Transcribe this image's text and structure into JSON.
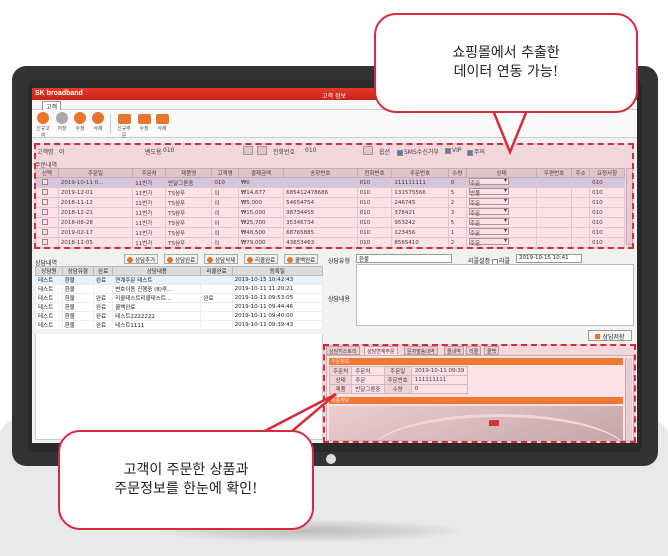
{
  "callouts": {
    "top": "쇼핑몰에서 추출한\n데이터 연동 가능!",
    "bottom": "고객이 주문한 상품과\n주문정보를 한눈에 확인!"
  },
  "app": {
    "brand": "SK broadband",
    "window_title": "고객 정보",
    "menu": "고객"
  },
  "toolbar": {
    "buttons": [
      "신규고객",
      "저장",
      "수정",
      "삭제",
      "신규주문",
      "수정",
      "삭제"
    ]
  },
  "customer": {
    "name_label": "고객명",
    "name_value": "이",
    "vendor_label": "벤도용",
    "vendor_value": "010",
    "phone_label": "전화번호",
    "phone_value": "010",
    "checks_label": "옵션",
    "checks": [
      "SMS수신거부",
      "VIP",
      "주의"
    ]
  },
  "orders": {
    "section_label": "주문내역",
    "columns": [
      "선택",
      "주문일",
      "주문처",
      "제품명",
      "고객명",
      "결제금액",
      "송장번호",
      "전화번호",
      "주문번호",
      "수량",
      "상태",
      "우편번호",
      "주소",
      "요청사항"
    ],
    "rows": [
      [
        "",
        "2019-10-11 0...",
        "11번가",
        "반달그론중",
        "010",
        "₩0",
        "",
        "010",
        "111111111",
        "0",
        "주문",
        "",
        "",
        "010"
      ],
      [
        "",
        "2019-12-01",
        "11번가",
        "TS샴푸",
        "이",
        "₩14,677",
        "685412478686",
        "010",
        "131575566",
        "5",
        "반품",
        "",
        "",
        "010"
      ],
      [
        "",
        "2018-11-12",
        "11번가",
        "TS샴푸",
        "이",
        "₩5,000",
        "54654754",
        "010",
        "246745",
        "2",
        "주문",
        "",
        "",
        "010"
      ],
      [
        "",
        "2018-12-21",
        "11번가",
        "TS샴푸",
        "이",
        "₩15,000",
        "98734455",
        "010",
        "378421",
        "3",
        "주문",
        "",
        "",
        "010"
      ],
      [
        "",
        "2018-08-28",
        "11번가",
        "TS샴푸",
        "이",
        "₩25,700",
        "35346734",
        "010",
        "953242",
        "5",
        "주문",
        "",
        "",
        "010"
      ],
      [
        "",
        "2019-02-17",
        "11번가",
        "TS샴푸",
        "이",
        "₩48,500",
        "68765885",
        "010",
        "123456",
        "1",
        "주문",
        "",
        "",
        "010"
      ],
      [
        "",
        "2018-12-05",
        "11번가",
        "TS샴푸",
        "이",
        "₩79,000",
        "43653463",
        "010",
        "8565410",
        "2",
        "주문",
        "",
        "",
        "010"
      ]
    ]
  },
  "consult": {
    "section_label": "상담내역",
    "buttons": [
      "상담추가",
      "상담완료",
      "상담삭제",
      "리콜완료",
      "콜백완료"
    ],
    "columns": [
      "상담원",
      "상담유형",
      "완료",
      "상담내용",
      "리콜완료",
      "등록일"
    ],
    "rows": [
      [
        "테스트",
        "환불",
        "완료",
        "연계주문 테스트",
        "",
        "2019-10-15 10:42:43"
      ],
      [
        "테스트",
        "환불",
        "",
        "변호이동 진행중 (8)루...",
        "",
        "2019-10-11 11:20:21"
      ],
      [
        "테스트",
        "환불",
        "완료",
        "리콜테스트리콜테스트...",
        "완료",
        "2019-10-11 09:53:05"
      ],
      [
        "테스트",
        "환불",
        "완료",
        "콜백완료",
        "",
        "2019-10-11 09:44:46"
      ],
      [
        "테스트",
        "환불",
        "완료",
        "테스트2222222",
        "",
        "2019-10-11 09:40:00"
      ],
      [
        "테스트",
        "환불",
        "완료",
        "테스트1111",
        "",
        "2019-10-11 09:39:43"
      ]
    ],
    "type_label": "상담유형",
    "type_value": "환불",
    "recall_label": "리콜설정",
    "recall_check": "리콜",
    "recall_date": "2019-10-15 10:41",
    "content_label": "상담내용",
    "save_label": "상담저장"
  },
  "detail_tabs": [
    "상담히스토리",
    "상담연계주문",
    "문자발송내역",
    "콜내역",
    "리콜",
    "콜백"
  ],
  "order_info": {
    "header": "주문정보",
    "rows": [
      [
        "주문처",
        "주문처",
        "주문일",
        "2019-10-11 09:39"
      ],
      [
        "상태",
        "주문",
        "주문번호",
        "111111111"
      ],
      [
        "제품",
        "반달그론중",
        "수량",
        "0"
      ]
    ],
    "product_header": "제품정보"
  }
}
